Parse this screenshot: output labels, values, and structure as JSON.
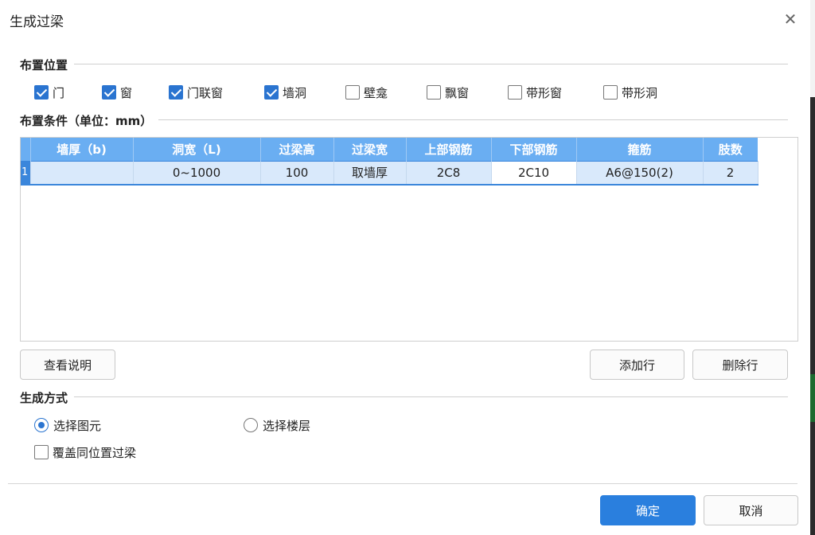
{
  "dialog": {
    "title": "生成过梁"
  },
  "placement": {
    "label": "布置位置",
    "options": [
      {
        "label": "门",
        "checked": true
      },
      {
        "label": "窗",
        "checked": true
      },
      {
        "label": "门联窗",
        "checked": true
      },
      {
        "label": "墙洞",
        "checked": true
      },
      {
        "label": "壁龛",
        "checked": false
      },
      {
        "label": "飘窗",
        "checked": false
      },
      {
        "label": "带形窗",
        "checked": false
      },
      {
        "label": "带形洞",
        "checked": false
      }
    ]
  },
  "conditions": {
    "label": "布置条件（单位：mm）",
    "columns": [
      "墙厚（b)",
      "洞宽（L)",
      "过梁高",
      "过梁宽",
      "上部钢筋",
      "下部钢筋",
      "箍筋",
      "肢数"
    ],
    "rows": [
      {
        "index": "1",
        "cells": [
          "",
          "0~1000",
          "100",
          "取墙厚",
          "2C8",
          "2C10",
          "A6@150(2)",
          "2"
        ]
      }
    ]
  },
  "buttons": {
    "view_help": "查看说明",
    "add_row": "添加行",
    "delete_row": "删除行",
    "ok": "确定",
    "cancel": "取消"
  },
  "mode": {
    "label": "生成方式",
    "options": [
      {
        "label": "选择图元",
        "selected": true
      },
      {
        "label": "选择楼层",
        "selected": false
      }
    ],
    "override": {
      "label": "覆盖同位置过梁",
      "checked": false
    }
  },
  "colors": {
    "accent": "#2a7fde",
    "header": "#6aaef2",
    "row": "#d9e9fb"
  }
}
